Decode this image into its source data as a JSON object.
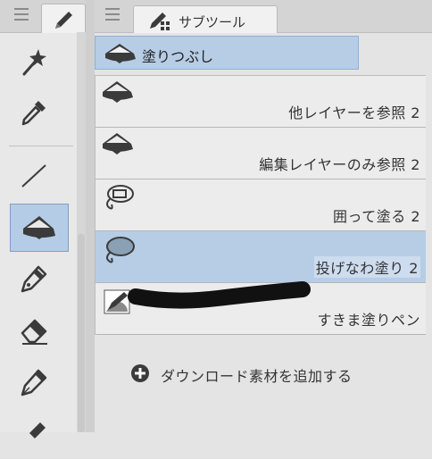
{
  "tool_panel": {
    "menu_icon": "hamburger-menu-icon",
    "tab_icon": "pen-icon",
    "tools": [
      {
        "icon": "magic-wand-icon",
        "selected": false
      },
      {
        "icon": "eyedropper-icon",
        "selected": false
      },
      {
        "icon": "line-figure-icon",
        "selected": false
      },
      {
        "icon": "fill-bucket-icon",
        "selected": true
      },
      {
        "icon": "pen-nib-icon",
        "selected": false
      },
      {
        "icon": "eraser-icon",
        "selected": false
      },
      {
        "icon": "fountain-pen-icon",
        "selected": false
      }
    ]
  },
  "sub_tool_panel": {
    "title": "サブツール",
    "title_icon": "sub-tool-icon",
    "group": {
      "label": "塗りつぶし",
      "icon": "fill-bucket-icon"
    },
    "items": [
      {
        "label": "他レイヤーを参照 2",
        "icon": "fill-bucket-icon",
        "active": false
      },
      {
        "label": "編集レイヤーのみ参照 2",
        "icon": "fill-bucket-icon",
        "active": false
      },
      {
        "label": "囲って塗る 2",
        "icon": "lasso-fill-icon",
        "active": false
      },
      {
        "label": "投げなわ塗り 2",
        "icon": "lasso-fill-icon",
        "active": true
      },
      {
        "label": "すきま塗りペン",
        "icon": "gap-fill-pen-icon",
        "active": false
      }
    ],
    "add_material": {
      "label": "ダウンロード素材を追加する",
      "icon": "plus-circle-icon"
    }
  },
  "colors": {
    "selection": "#b6cde5",
    "selection_border": "#8fb0d6",
    "panel_bg": "#ececec",
    "icon_dark": "#3b3b3b"
  }
}
